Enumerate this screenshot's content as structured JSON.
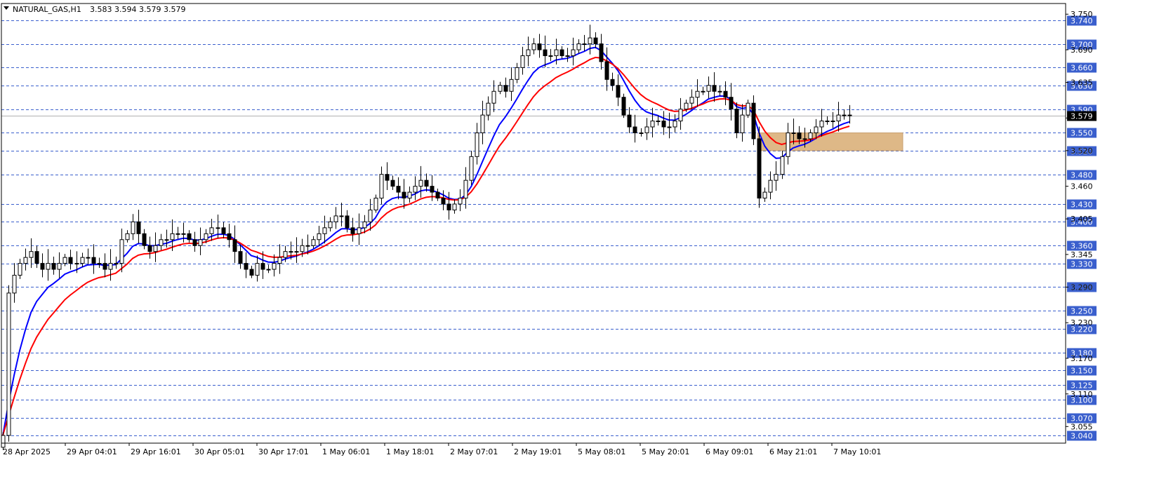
{
  "header": {
    "symbol": "NATURAL_GAS,H1",
    "ohlc": "3.583 3.594 3.579 3.579"
  },
  "chart_data": {
    "type": "candlestick",
    "symbol": "NATURAL_GAS",
    "timeframe": "H1",
    "ylim": [
      3.027,
      3.768
    ],
    "y_ticks": [
      "3.750",
      "3.690",
      "3.635",
      "3.575",
      "3.520",
      "3.460",
      "3.405",
      "3.345",
      "3.290",
      "3.230",
      "3.170",
      "3.110",
      "3.055"
    ],
    "x_labels": [
      "28 Apr 2025",
      "29 Apr 04:01",
      "29 Apr 16:01",
      "30 Apr 05:01",
      "30 Apr 17:01",
      "1 May 06:01",
      "1 May 18:01",
      "2 May 07:01",
      "2 May 19:01",
      "5 May 08:01",
      "5 May 20:01",
      "6 May 09:01",
      "6 May 21:01",
      "7 May 10:01"
    ],
    "level_lines": [
      3.74,
      3.7,
      3.66,
      3.63,
      3.59,
      3.55,
      3.52,
      3.48,
      3.43,
      3.4,
      3.36,
      3.33,
      3.29,
      3.25,
      3.22,
      3.18,
      3.15,
      3.125,
      3.1,
      3.07,
      3.04
    ],
    "current_price": 3.579,
    "zone": {
      "low": 3.52,
      "high": 3.55
    },
    "closes": [
      3.04,
      3.28,
      3.31,
      3.33,
      3.34,
      3.35,
      3.33,
      3.32,
      3.33,
      3.32,
      3.33,
      3.34,
      3.33,
      3.33,
      3.34,
      3.34,
      3.33,
      3.33,
      3.32,
      3.33,
      3.33,
      3.37,
      3.38,
      3.4,
      3.38,
      3.36,
      3.35,
      3.36,
      3.37,
      3.37,
      3.38,
      3.38,
      3.38,
      3.37,
      3.36,
      3.37,
      3.38,
      3.39,
      3.39,
      3.38,
      3.37,
      3.35,
      3.33,
      3.32,
      3.31,
      3.33,
      3.32,
      3.32,
      3.33,
      3.34,
      3.35,
      3.35,
      3.35,
      3.36,
      3.36,
      3.37,
      3.38,
      3.39,
      3.4,
      3.41,
      3.41,
      3.39,
      3.38,
      3.39,
      3.4,
      3.42,
      3.44,
      3.48,
      3.47,
      3.46,
      3.45,
      3.44,
      3.45,
      3.46,
      3.47,
      3.46,
      3.45,
      3.44,
      3.43,
      3.42,
      3.43,
      3.44,
      3.47,
      3.51,
      3.55,
      3.58,
      3.6,
      3.62,
      3.63,
      3.62,
      3.64,
      3.66,
      3.68,
      3.69,
      3.7,
      3.69,
      3.68,
      3.68,
      3.69,
      3.68,
      3.68,
      3.69,
      3.7,
      3.7,
      3.71,
      3.7,
      3.67,
      3.64,
      3.63,
      3.61,
      3.58,
      3.56,
      3.55,
      3.55,
      3.56,
      3.57,
      3.57,
      3.56,
      3.56,
      3.57,
      3.59,
      3.6,
      3.61,
      3.62,
      3.62,
      3.63,
      3.62,
      3.62,
      3.61,
      3.59,
      3.55,
      3.58,
      3.6,
      3.54,
      3.44,
      3.45,
      3.47,
      3.48,
      3.51,
      3.55,
      3.55,
      3.54,
      3.54,
      3.55,
      3.56,
      3.57,
      3.57,
      3.57,
      3.58,
      3.58,
      3.579
    ],
    "series": [
      {
        "name": "",
        "color": "#0000ff"
      },
      {
        "name": "",
        "color": "#ff0000"
      }
    ],
    "grid": true
  }
}
